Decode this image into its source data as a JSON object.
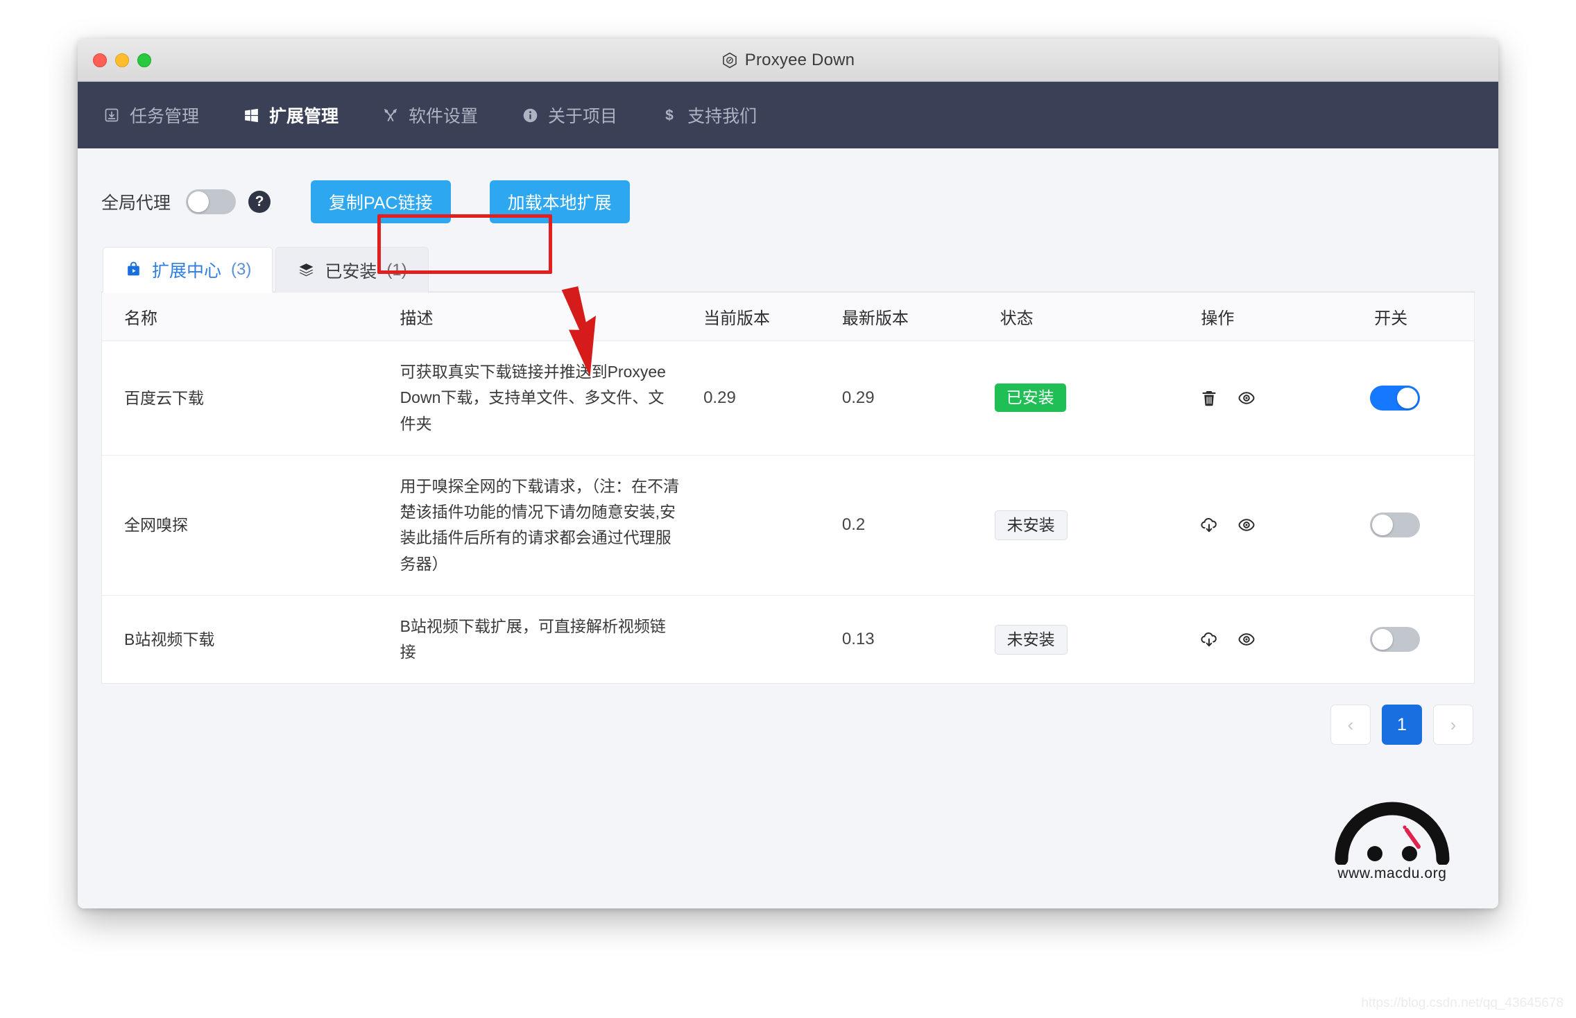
{
  "window": {
    "title": "Proxyee Down",
    "app_icon": "hexagon-app-icon",
    "controls": [
      "close-button",
      "minimize-button",
      "zoom-button"
    ]
  },
  "navbar": {
    "items": [
      {
        "label": "任务管理",
        "icon": "download-task-icon",
        "active": false
      },
      {
        "label": "扩展管理",
        "icon": "windows-icon",
        "active": true
      },
      {
        "label": "软件设置",
        "icon": "tools-icon",
        "active": false
      },
      {
        "label": "关于项目",
        "icon": "info-icon",
        "active": false
      },
      {
        "label": "支持我们",
        "icon": "dollar-icon",
        "active": false
      }
    ]
  },
  "toolbar": {
    "proxy_label": "全局代理",
    "proxy_enabled": false,
    "help_label": "?",
    "copy_pac_label": "复制PAC链接",
    "load_local_label": "加载本地扩展"
  },
  "tabs": [
    {
      "label": "扩展中心",
      "count": "(3)",
      "icon": "store-bag-icon",
      "active": true
    },
    {
      "label": "已安装",
      "count": "(1)",
      "icon": "layers-icon",
      "active": false
    }
  ],
  "table": {
    "headers": {
      "name": "名称",
      "desc": "描述",
      "current_version": "当前版本",
      "latest_version": "最新版本",
      "status": "状态",
      "actions": "操作",
      "toggle": "开关"
    },
    "rows": [
      {
        "name": "百度云下载",
        "desc": "可获取真实下载链接并推送到Proxyee Down下载，支持单文件、多文件、文件夹",
        "current_version": "0.29",
        "latest_version": "0.29",
        "status": "已安装",
        "status_kind": "installed",
        "actions": [
          "trash-icon",
          "eye-icon"
        ],
        "toggle_on": true
      },
      {
        "name": "全网嗅探",
        "desc": "用于嗅探全网的下载请求，（注：在不清楚该插件功能的情况下请勿随意安装,安装此插件后所有的请求都会通过代理服务器）",
        "current_version": "",
        "latest_version": "0.2",
        "status": "未安装",
        "status_kind": "notinstalled",
        "actions": [
          "cloud-download-icon",
          "eye-icon"
        ],
        "toggle_on": false
      },
      {
        "name": "B站视频下载",
        "desc": "B站视频下载扩展，可直接解析视频链接",
        "current_version": "",
        "latest_version": "0.13",
        "status": "未安装",
        "status_kind": "notinstalled",
        "actions": [
          "cloud-download-icon",
          "eye-icon"
        ],
        "toggle_on": false
      }
    ]
  },
  "pagination": {
    "prev": "‹",
    "current_page": "1",
    "next": "›"
  },
  "watermark": {
    "text": "www.macdu.org"
  },
  "footer": {
    "note": "https://blog.csdn.net/qq_43645678"
  },
  "annotation": {
    "highlight_target": "copy-pac-button",
    "color": "#e31e1e"
  },
  "colors": {
    "navbar_bg": "#3a4055",
    "primary_button": "#2ca7f0",
    "accent_blue": "#1677ff",
    "installed_green": "#20bf55",
    "page_active": "#1a6fe0"
  }
}
